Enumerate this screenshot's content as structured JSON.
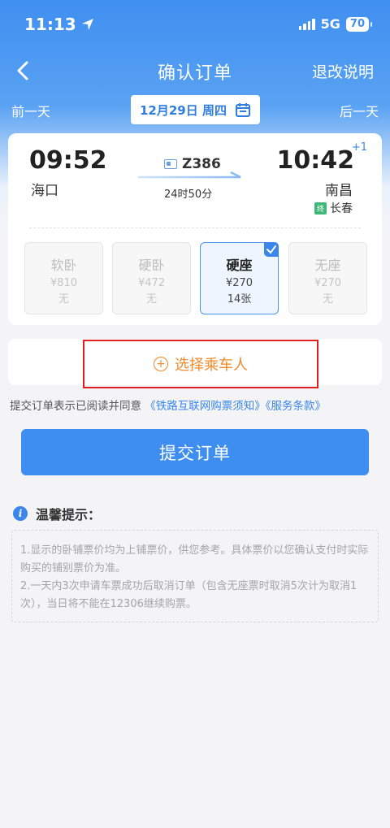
{
  "status_bar": {
    "time": "11:13",
    "network": "5G",
    "battery": "70"
  },
  "nav": {
    "title": "确认订单",
    "right_label": "退改说明"
  },
  "date_row": {
    "prev": "前一天",
    "date": "12月29日 周四",
    "next": "后一天"
  },
  "train": {
    "departure_time": "09:52",
    "departure_station": "海口",
    "train_number": "Z386",
    "duration": "24时50分",
    "arrival_time": "10:42",
    "day_offset": "+1",
    "arrival_station": "南昌",
    "via_badge": "终",
    "via_station": "长春"
  },
  "seats": [
    {
      "name": "软卧",
      "price": "¥810",
      "count": "无"
    },
    {
      "name": "硬卧",
      "price": "¥472",
      "count": "无"
    },
    {
      "name": "硬座",
      "price": "¥270",
      "count": "14张",
      "selected": true
    },
    {
      "name": "无座",
      "price": "¥270",
      "count": "无"
    }
  ],
  "passenger": {
    "label": "选择乘车人"
  },
  "agreement": {
    "prefix": "提交订单表示已阅读并同意",
    "link1": "《铁路互联网购票须知》",
    "link2": "《服务条款》"
  },
  "submit_label": "提交订单",
  "tips": {
    "title": "温馨提示：",
    "line1": "1.显示的卧铺票价均为上铺票价，供您参考。具体票价以您确认支付时实际购买的铺别票价为准。",
    "line2": "2.一天内3次申请车票成功后取消订单（包含无座票时取消5次计为取消1次），当日将不能在12306继续购票。"
  },
  "colors": {
    "primary": "#3d8ef0",
    "accent_orange": "#f08a2a",
    "highlight_red": "#e02020"
  }
}
